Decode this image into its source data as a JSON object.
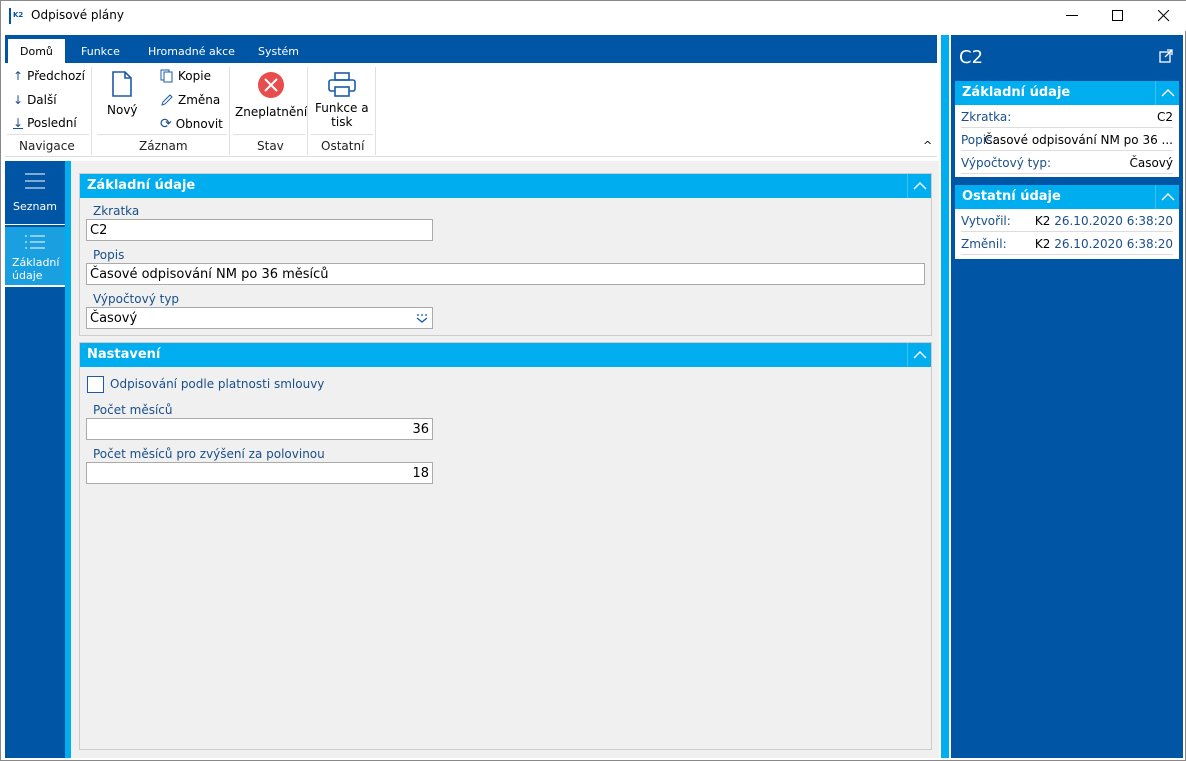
{
  "window": {
    "title": "Odpisové plány",
    "app_icon_text": "K2"
  },
  "ribbon": {
    "tabs": [
      "Domů",
      "Funkce",
      "Hromadné akce",
      "Systém"
    ],
    "active_tab": "Domů",
    "groups": {
      "navigace": {
        "label": "Navigace",
        "items": [
          "Předchozí",
          "Další",
          "Poslední"
        ]
      },
      "zaznam": {
        "label": "Záznam",
        "new": "Nový",
        "items": [
          "Kopie",
          "Změna",
          "Obnovit"
        ]
      },
      "stav": {
        "label": "Stav",
        "button": "Zneplatnění"
      },
      "ostatni": {
        "label": "Ostatní",
        "button_line1": "Funkce a",
        "button_line2": "tisk"
      }
    }
  },
  "sidebar": {
    "items": [
      {
        "label": "Seznam",
        "icon": "hamburger-icon"
      },
      {
        "label_line1": "Základní",
        "label_line2": "údaje",
        "icon": "list-icon",
        "active": true
      }
    ]
  },
  "form": {
    "basic": {
      "title": "Základní údaje",
      "zkratka_label": "Zkratka",
      "zkratka": "C2",
      "popis_label": "Popis",
      "popis": "Časové odpisování NM po 36 měsíců",
      "typ_label": "Výpočtový typ",
      "typ": "Časový"
    },
    "settings": {
      "title": "Nastavení",
      "checkbox_label": "Odpisování podle platnosti smlouvy",
      "checkbox_checked": false,
      "months_label": "Počet měsíců",
      "months": "36",
      "half_label": "Počet měsíců pro zvýšení za polovinou",
      "half": "18"
    }
  },
  "info": {
    "title": "C2",
    "basic": {
      "title": "Základní údaje",
      "rows": [
        {
          "k": "Zkratka:",
          "v": "C2"
        },
        {
          "k": "Popis:",
          "v": "Časové odpisování NM po 36 ..."
        },
        {
          "k": "Výpočtový typ:",
          "v": "Časový"
        }
      ]
    },
    "other": {
      "title": "Ostatní údaje",
      "rows": [
        {
          "k": "Vytvořil:",
          "user": "K2",
          "date": "26.10.2020 6:38:20"
        },
        {
          "k": "Změnil:",
          "user": "K2",
          "date": "26.10.2020 6:38:20"
        }
      ]
    }
  },
  "colors": {
    "brand": "#0055a5",
    "accent": "#00aeef",
    "close_icon": "#e84c4c"
  }
}
